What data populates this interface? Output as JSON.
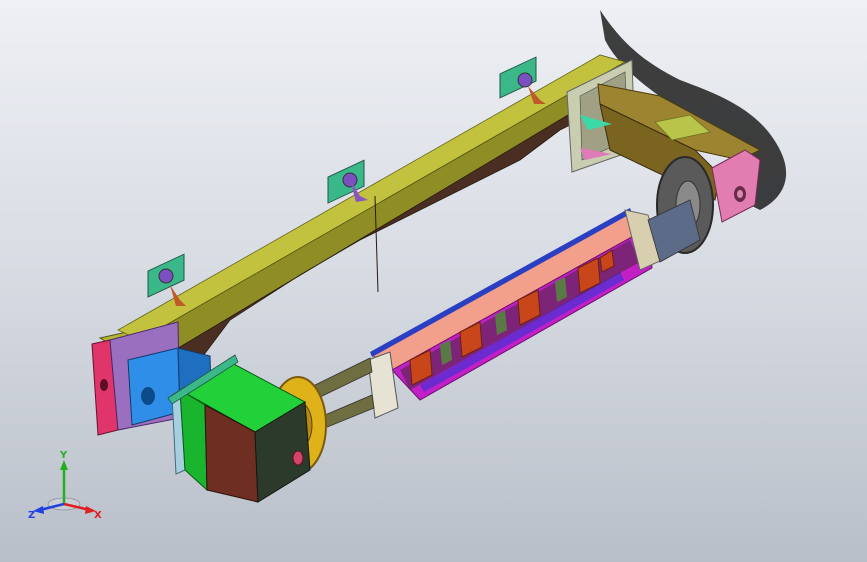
{
  "viewport": {
    "background_top": "#eef0f4",
    "background_bottom": "#b9bfc9"
  },
  "model": {
    "colors": {
      "beam_top": "#b3b336",
      "beam_side": "#8a8a22",
      "beam_inner": "#4b2e22",
      "end_cap_left": "#9b6fbf",
      "pink_plate": "#e0356b",
      "blue_block": "#2f8fe8",
      "green_box": "#22d13a",
      "brown_face": "#6e2f22",
      "gold_wheel": "#e0b21a",
      "right_housing": "#7a6420",
      "right_housing_top": "#9d8430",
      "right_light_panel": "#c9ceb0",
      "salmon_rail": "#f2a08c",
      "magenta_base": "#c21fc7",
      "purple_strip": "#6b2bd1",
      "orange_clamp": "#c9461a",
      "olive_green": "#5a7a45",
      "teal_bracket": "#3bb88a",
      "dark_shadow": "#2a2a2a"
    }
  },
  "triad": {
    "x_label": "X",
    "y_label": "Y",
    "z_label": "Z",
    "x_color": "#e02020",
    "y_color": "#20b020",
    "z_color": "#2040e0"
  }
}
